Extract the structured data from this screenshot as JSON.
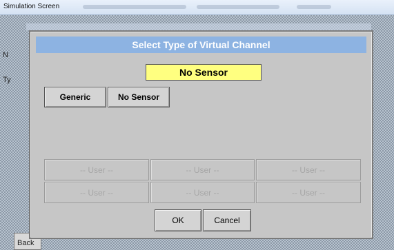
{
  "window": {
    "title": "Simulation Screen"
  },
  "background": {
    "labels": [
      "N",
      "Ty"
    ],
    "back_label": "Back"
  },
  "dialog": {
    "title": "Select Type of Virtual Channel",
    "selected_value": "No Sensor",
    "type_buttons": [
      "Generic",
      "No Sensor"
    ],
    "user_buttons": [
      [
        "-- User --",
        "-- User --",
        "-- User --"
      ],
      [
        "-- User --",
        "-- User --",
        "-- User --"
      ]
    ],
    "ok_label": "OK",
    "cancel_label": "Cancel"
  },
  "colors": {
    "header": "#8db3e2",
    "selected_field": "#ffff80",
    "dialog_bg": "#c6c6c6"
  }
}
